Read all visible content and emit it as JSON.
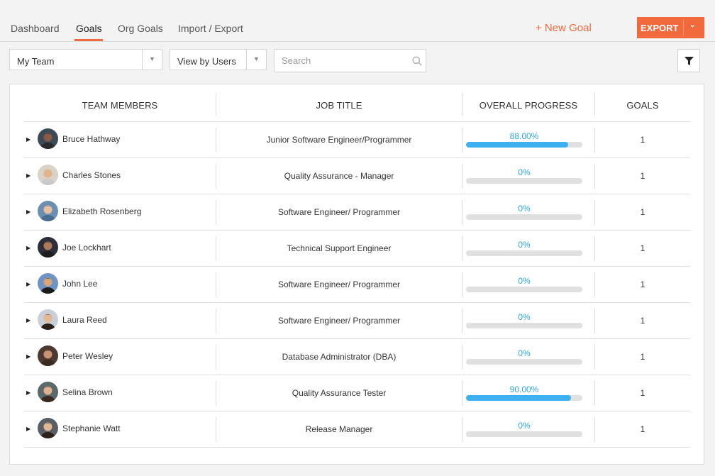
{
  "tabs": [
    {
      "label": "Dashboard"
    },
    {
      "label": "Goals"
    },
    {
      "label": "Org Goals"
    },
    {
      "label": "Import / Export"
    }
  ],
  "active_tab": "Goals",
  "new_goal_label": "+ New Goal",
  "export_label": "EXPORT",
  "team_select": {
    "value": "My Team"
  },
  "view_select": {
    "value": "View by Users"
  },
  "search": {
    "placeholder": "Search",
    "value": ""
  },
  "table": {
    "columns": [
      "TEAM MEMBERS",
      "JOB TITLE",
      "OVERALL PROGRESS",
      "GOALS"
    ],
    "rows": [
      {
        "name": "Bruce Hathway",
        "job": "Junior Software Engineer/Programmer",
        "progress_label": "88.00%",
        "progress": 0.88,
        "goals": "1"
      },
      {
        "name": "Charles Stones",
        "job": "Quality Assurance - Manager",
        "progress_label": "0%",
        "progress": 0,
        "goals": "1"
      },
      {
        "name": "Elizabeth Rosenberg",
        "job": "Software Engineer/ Programmer",
        "progress_label": "0%",
        "progress": 0,
        "goals": "1"
      },
      {
        "name": "Joe Lockhart",
        "job": "Technical Support Engineer",
        "progress_label": "0%",
        "progress": 0,
        "goals": "1"
      },
      {
        "name": "John Lee",
        "job": "Software Engineer/ Programmer",
        "progress_label": "0%",
        "progress": 0,
        "goals": "1"
      },
      {
        "name": "Laura Reed",
        "job": "Software Engineer/ Programmer",
        "progress_label": "0%",
        "progress": 0,
        "goals": "1"
      },
      {
        "name": "Peter Wesley",
        "job": "Database Administrator (DBA)",
        "progress_label": "0%",
        "progress": 0,
        "goals": "1"
      },
      {
        "name": "Selina Brown",
        "job": "Quality Assurance Tester",
        "progress_label": "90.00%",
        "progress": 0.9,
        "goals": "1"
      },
      {
        "name": "Stephanie Watt",
        "job": "Release Manager",
        "progress_label": "0%",
        "progress": 0,
        "goals": "1"
      }
    ]
  },
  "icons": {
    "search": "search-icon",
    "filter": "filter-icon",
    "expand": "caret-right-icon",
    "dropdown": "caret-down-icon"
  },
  "colors": {
    "accent": "#f26a3c",
    "progress_fill": "#3db1f0",
    "progress_text": "#2aa6e8",
    "progress_track": "#e0e0e0"
  }
}
